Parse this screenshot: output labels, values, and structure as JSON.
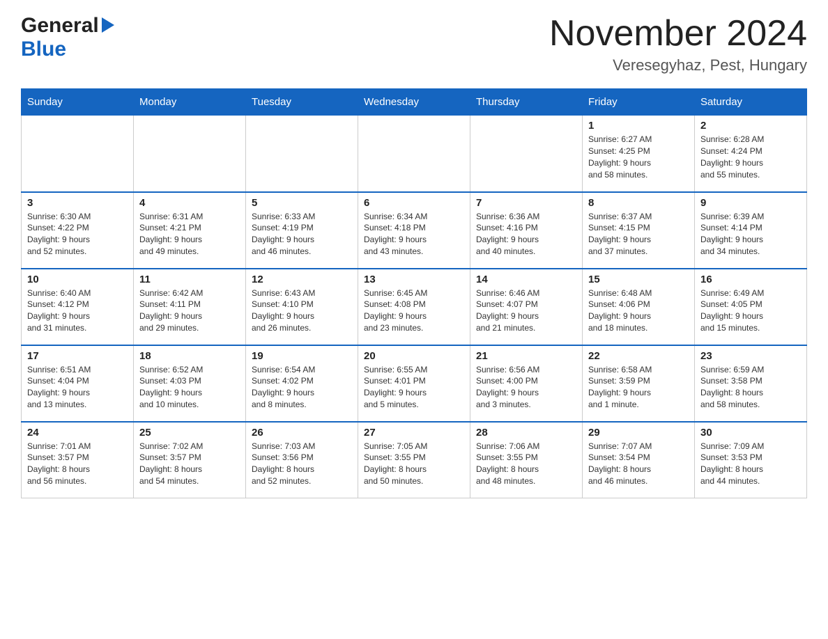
{
  "header": {
    "logo_general": "General",
    "logo_blue": "Blue",
    "month_title": "November 2024",
    "location": "Veresegyhaz, Pest, Hungary"
  },
  "days_of_week": [
    "Sunday",
    "Monday",
    "Tuesday",
    "Wednesday",
    "Thursday",
    "Friday",
    "Saturday"
  ],
  "weeks": [
    [
      {
        "day": "",
        "info": ""
      },
      {
        "day": "",
        "info": ""
      },
      {
        "day": "",
        "info": ""
      },
      {
        "day": "",
        "info": ""
      },
      {
        "day": "",
        "info": ""
      },
      {
        "day": "1",
        "info": "Sunrise: 6:27 AM\nSunset: 4:25 PM\nDaylight: 9 hours\nand 58 minutes."
      },
      {
        "day": "2",
        "info": "Sunrise: 6:28 AM\nSunset: 4:24 PM\nDaylight: 9 hours\nand 55 minutes."
      }
    ],
    [
      {
        "day": "3",
        "info": "Sunrise: 6:30 AM\nSunset: 4:22 PM\nDaylight: 9 hours\nand 52 minutes."
      },
      {
        "day": "4",
        "info": "Sunrise: 6:31 AM\nSunset: 4:21 PM\nDaylight: 9 hours\nand 49 minutes."
      },
      {
        "day": "5",
        "info": "Sunrise: 6:33 AM\nSunset: 4:19 PM\nDaylight: 9 hours\nand 46 minutes."
      },
      {
        "day": "6",
        "info": "Sunrise: 6:34 AM\nSunset: 4:18 PM\nDaylight: 9 hours\nand 43 minutes."
      },
      {
        "day": "7",
        "info": "Sunrise: 6:36 AM\nSunset: 4:16 PM\nDaylight: 9 hours\nand 40 minutes."
      },
      {
        "day": "8",
        "info": "Sunrise: 6:37 AM\nSunset: 4:15 PM\nDaylight: 9 hours\nand 37 minutes."
      },
      {
        "day": "9",
        "info": "Sunrise: 6:39 AM\nSunset: 4:14 PM\nDaylight: 9 hours\nand 34 minutes."
      }
    ],
    [
      {
        "day": "10",
        "info": "Sunrise: 6:40 AM\nSunset: 4:12 PM\nDaylight: 9 hours\nand 31 minutes."
      },
      {
        "day": "11",
        "info": "Sunrise: 6:42 AM\nSunset: 4:11 PM\nDaylight: 9 hours\nand 29 minutes."
      },
      {
        "day": "12",
        "info": "Sunrise: 6:43 AM\nSunset: 4:10 PM\nDaylight: 9 hours\nand 26 minutes."
      },
      {
        "day": "13",
        "info": "Sunrise: 6:45 AM\nSunset: 4:08 PM\nDaylight: 9 hours\nand 23 minutes."
      },
      {
        "day": "14",
        "info": "Sunrise: 6:46 AM\nSunset: 4:07 PM\nDaylight: 9 hours\nand 21 minutes."
      },
      {
        "day": "15",
        "info": "Sunrise: 6:48 AM\nSunset: 4:06 PM\nDaylight: 9 hours\nand 18 minutes."
      },
      {
        "day": "16",
        "info": "Sunrise: 6:49 AM\nSunset: 4:05 PM\nDaylight: 9 hours\nand 15 minutes."
      }
    ],
    [
      {
        "day": "17",
        "info": "Sunrise: 6:51 AM\nSunset: 4:04 PM\nDaylight: 9 hours\nand 13 minutes."
      },
      {
        "day": "18",
        "info": "Sunrise: 6:52 AM\nSunset: 4:03 PM\nDaylight: 9 hours\nand 10 minutes."
      },
      {
        "day": "19",
        "info": "Sunrise: 6:54 AM\nSunset: 4:02 PM\nDaylight: 9 hours\nand 8 minutes."
      },
      {
        "day": "20",
        "info": "Sunrise: 6:55 AM\nSunset: 4:01 PM\nDaylight: 9 hours\nand 5 minutes."
      },
      {
        "day": "21",
        "info": "Sunrise: 6:56 AM\nSunset: 4:00 PM\nDaylight: 9 hours\nand 3 minutes."
      },
      {
        "day": "22",
        "info": "Sunrise: 6:58 AM\nSunset: 3:59 PM\nDaylight: 9 hours\nand 1 minute."
      },
      {
        "day": "23",
        "info": "Sunrise: 6:59 AM\nSunset: 3:58 PM\nDaylight: 8 hours\nand 58 minutes."
      }
    ],
    [
      {
        "day": "24",
        "info": "Sunrise: 7:01 AM\nSunset: 3:57 PM\nDaylight: 8 hours\nand 56 minutes."
      },
      {
        "day": "25",
        "info": "Sunrise: 7:02 AM\nSunset: 3:57 PM\nDaylight: 8 hours\nand 54 minutes."
      },
      {
        "day": "26",
        "info": "Sunrise: 7:03 AM\nSunset: 3:56 PM\nDaylight: 8 hours\nand 52 minutes."
      },
      {
        "day": "27",
        "info": "Sunrise: 7:05 AM\nSunset: 3:55 PM\nDaylight: 8 hours\nand 50 minutes."
      },
      {
        "day": "28",
        "info": "Sunrise: 7:06 AM\nSunset: 3:55 PM\nDaylight: 8 hours\nand 48 minutes."
      },
      {
        "day": "29",
        "info": "Sunrise: 7:07 AM\nSunset: 3:54 PM\nDaylight: 8 hours\nand 46 minutes."
      },
      {
        "day": "30",
        "info": "Sunrise: 7:09 AM\nSunset: 3:53 PM\nDaylight: 8 hours\nand 44 minutes."
      }
    ]
  ]
}
